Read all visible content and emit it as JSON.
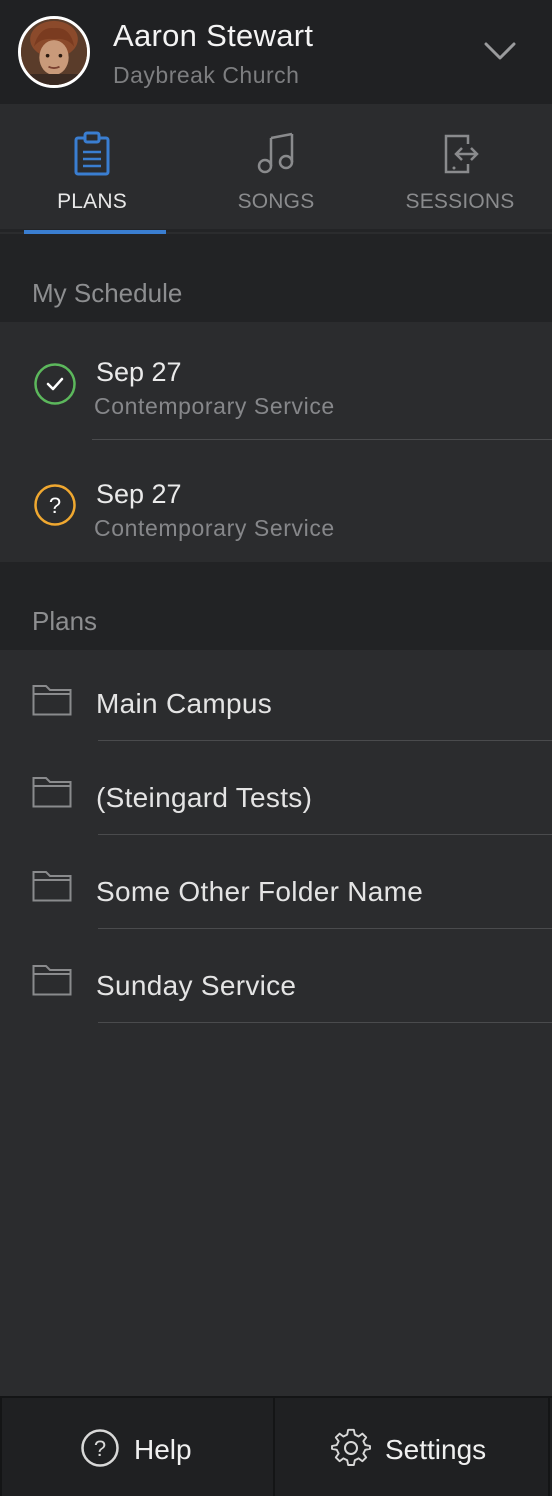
{
  "header": {
    "user_name": "Aaron Stewart",
    "church_name": "Daybreak Church",
    "avatar_icon": "user-avatar",
    "expand_icon": "chevron-down-icon"
  },
  "tabs": [
    {
      "label": "PLANS",
      "icon": "clipboard-icon",
      "active": true
    },
    {
      "label": "SONGS",
      "icon": "music-note-icon",
      "active": false
    },
    {
      "label": "SESSIONS",
      "icon": "session-exit-icon",
      "active": false
    }
  ],
  "my_schedule": {
    "title": "My Schedule",
    "items": [
      {
        "date": "Sep 27",
        "service": "Contemporary Service",
        "status": "confirmed",
        "status_icon": "check-circle-icon",
        "status_color": "#5cb85c"
      },
      {
        "date": "Sep 27",
        "service": "Contemporary Service",
        "status": "pending",
        "status_icon": "question-circle-icon",
        "status_color": "#f0a830"
      }
    ]
  },
  "plans": {
    "title": "Plans",
    "folders": [
      {
        "name": "Main Campus",
        "icon": "folder-icon"
      },
      {
        "name": "(Steingard Tests)",
        "icon": "folder-icon"
      },
      {
        "name": "Some Other Folder Name",
        "icon": "folder-icon"
      },
      {
        "name": "Sunday Service",
        "icon": "folder-icon"
      }
    ]
  },
  "footer": {
    "help_label": "Help",
    "help_icon": "help-circle-icon",
    "settings_label": "Settings",
    "settings_icon": "gear-icon"
  },
  "colors": {
    "accent": "#3a7ed1",
    "background": "#2b2c2e",
    "header_bg": "#202123",
    "confirmed": "#5cb85c",
    "pending": "#f0a830"
  }
}
